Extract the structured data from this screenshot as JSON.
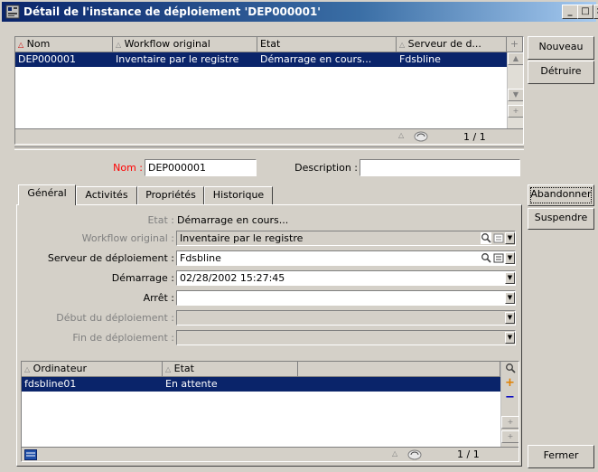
{
  "window": {
    "title": "Détail de l'instance de déploiement 'DEP000001'",
    "controls": [
      "_",
      "□",
      "×"
    ]
  },
  "top_list": {
    "columns": [
      "Nom",
      "Workflow original",
      "Etat",
      "Serveur de d..."
    ],
    "rows": [
      {
        "nom": "DEP000001",
        "workflow": "Inventaire par le registre",
        "etat": "Démarrage en cours...",
        "serveur": "Fdsbline"
      }
    ],
    "page": "1 / 1"
  },
  "buttons": {
    "nouveau": "Nouveau",
    "detruire": "Détruire",
    "abandonner": "Abandonner",
    "suspendre": "Suspendre",
    "fermer": "Fermer"
  },
  "form": {
    "nom_label": "Nom :",
    "nom_value": "DEP000001",
    "description_label": "Description :",
    "description_value": ""
  },
  "tabs": [
    "Général",
    "Activités",
    "Propriétés",
    "Historique"
  ],
  "general": {
    "etat_label": "Etat :",
    "etat_value": "Démarrage en cours...",
    "workflow_label": "Workflow original :",
    "workflow_value": "Inventaire par le registre",
    "serveur_label": "Serveur de déploiement :",
    "serveur_value": "Fdsbline",
    "demarrage_label": "Démarrage :",
    "demarrage_value": "02/28/2002 15:27:45",
    "arret_label": "Arrêt :",
    "arret_value": "",
    "debut_label": "Début du déploiement :",
    "debut_value": "",
    "fin_label": "Fin de déploiement :",
    "fin_value": ""
  },
  "bottom_list": {
    "columns": [
      "Ordinateur",
      "Etat"
    ],
    "rows": [
      {
        "ordinateur": "fdsbline01",
        "etat": "En attente"
      }
    ],
    "page": "1 / 1"
  },
  "colors": {
    "selection": "#0a246a",
    "required_label": "#ff0000",
    "face": "#d4d0c8"
  }
}
